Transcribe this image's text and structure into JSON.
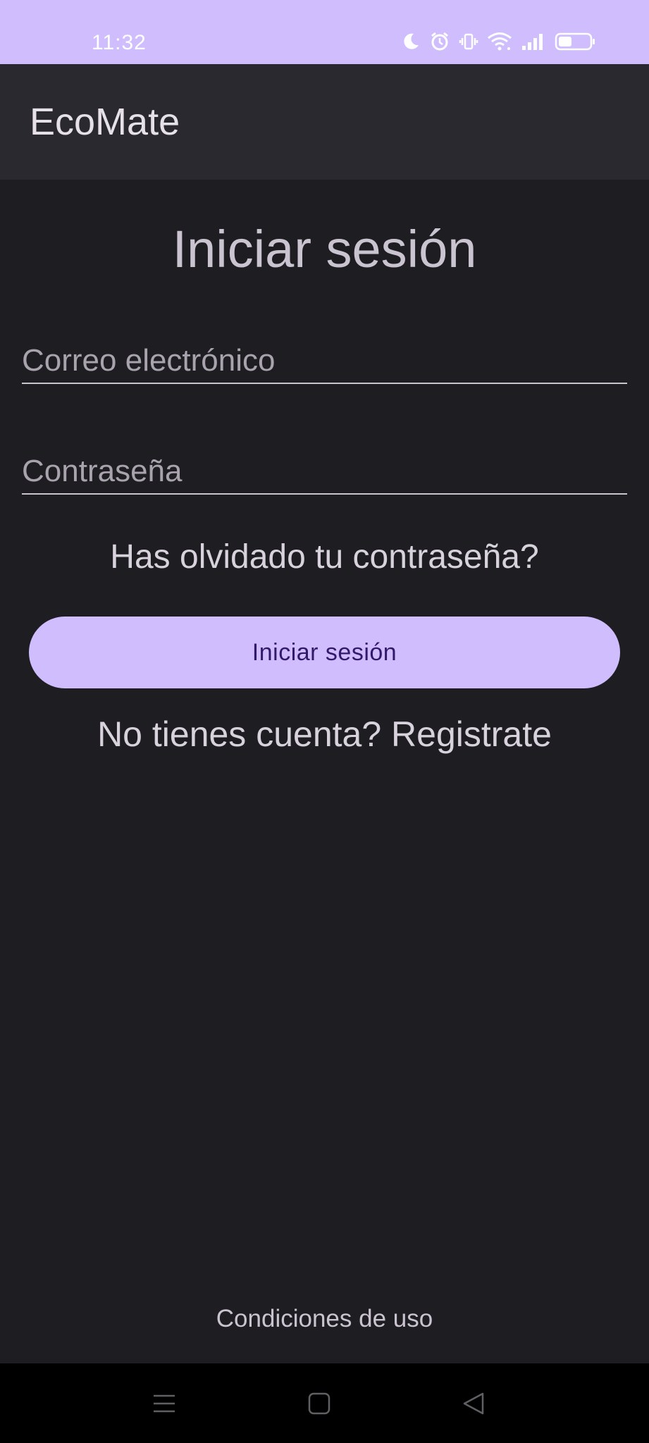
{
  "status_bar": {
    "time": "11:32",
    "icons": [
      "moon-icon",
      "alarm-icon",
      "vibrate-icon",
      "wifi-icon",
      "signal-icon",
      "battery-icon"
    ]
  },
  "app_bar": {
    "title": "EcoMate"
  },
  "login": {
    "title": "Iniciar sesión",
    "email_placeholder": "Correo electrónico",
    "email_value": "",
    "password_placeholder": "Contraseña",
    "password_value": "",
    "forgot_password": "Has olvidado tu contraseña?",
    "submit_label": "Iniciar sesión",
    "register_prompt": "No tienes cuenta? Registrate"
  },
  "footer": {
    "terms": "Condiciones de uso"
  },
  "nav_bar": {
    "icons": [
      "menu-icon",
      "home-icon",
      "back-icon"
    ]
  },
  "colors": {
    "accent": "#cfbdfe",
    "background": "#1e1d22",
    "app_bar": "#2b2930",
    "button_text": "#33196b"
  }
}
